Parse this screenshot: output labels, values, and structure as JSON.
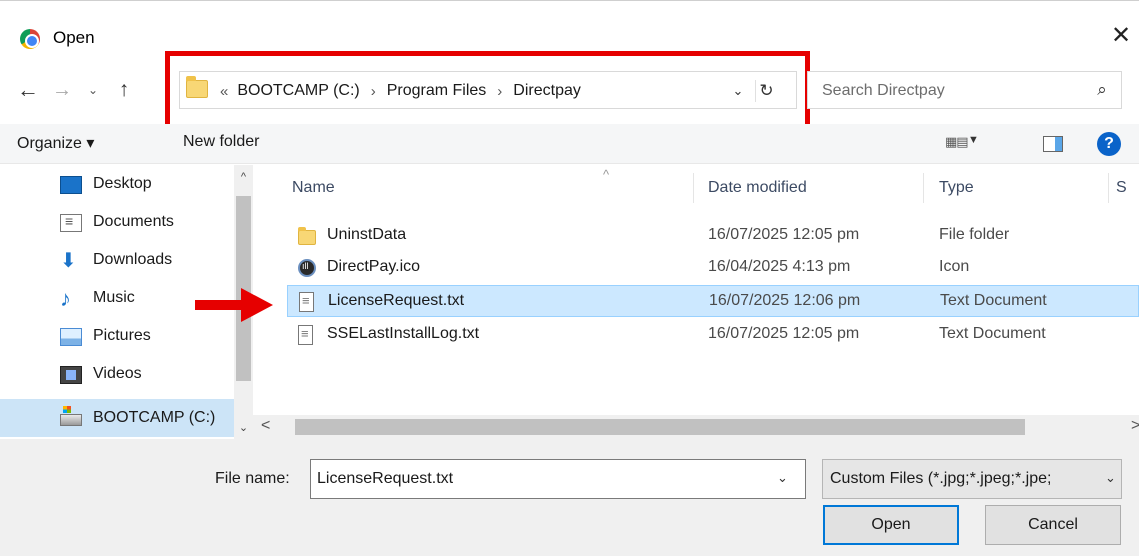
{
  "window": {
    "title": "Open",
    "close_glyph": "✕"
  },
  "nav_buttons": {
    "back": "←",
    "forward": "→",
    "recent": "⌄",
    "up": "↑"
  },
  "address": {
    "overflow": "«",
    "crumbs": [
      "BOOTCAMP (C:)",
      "Program Files",
      "Directpay"
    ],
    "separator": "›",
    "dropdown": "⌄",
    "refresh": "↻"
  },
  "search": {
    "placeholder": "Search Directpay",
    "icon": "⌕"
  },
  "toolbar": {
    "organize_label": "Organize ▾",
    "new_folder_label": "New folder",
    "view_glyph": "▦▤",
    "view_dropdown": "▼",
    "help_glyph": "?"
  },
  "sidebar": {
    "items": [
      {
        "label": "Desktop",
        "icon": "desktop-icon"
      },
      {
        "label": "Documents",
        "icon": "documents-icon"
      },
      {
        "label": "Downloads",
        "icon": "downloads-icon"
      },
      {
        "label": "Music",
        "icon": "music-icon"
      },
      {
        "label": "Pictures",
        "icon": "pictures-icon"
      },
      {
        "label": "Videos",
        "icon": "videos-icon"
      },
      {
        "label": "BOOTCAMP (C:)",
        "icon": "drive-icon",
        "selected": true
      }
    ],
    "scroll_up": "^",
    "scroll_down": "⌄",
    "down_glyph": "⬇",
    "music_glyph": "♪"
  },
  "columns": {
    "name": "Name",
    "date": "Date modified",
    "type": "Type",
    "size": "S",
    "sort_glyph": "^"
  },
  "files": [
    {
      "name": "UninstData",
      "date": "16/07/2025 12:05 pm",
      "type": "File folder",
      "icon": "folder-icon"
    },
    {
      "name": "DirectPay.ico",
      "date": "16/04/2025 4:13 pm",
      "type": "Icon",
      "icon": "ico-file-icon"
    },
    {
      "name": "LicenseRequest.txt",
      "date": "16/07/2025 12:06 pm",
      "type": "Text Document",
      "icon": "text-file-icon",
      "selected": true
    },
    {
      "name": "SSELastInstallLog.txt",
      "date": "16/07/2025 12:05 pm",
      "type": "Text Document",
      "icon": "text-file-icon"
    }
  ],
  "hscroll": {
    "left": "<",
    "right": ">"
  },
  "bottom": {
    "file_name_label": "File name:",
    "file_name_value": "LicenseRequest.txt",
    "file_name_dropdown": "⌄",
    "filter_value": "Custom Files (*.jpg;*.jpeg;*.jpe;",
    "filter_dropdown": "⌄",
    "open_label": "Open",
    "cancel_label": "Cancel"
  },
  "annotation": {
    "color": "#e60000"
  }
}
